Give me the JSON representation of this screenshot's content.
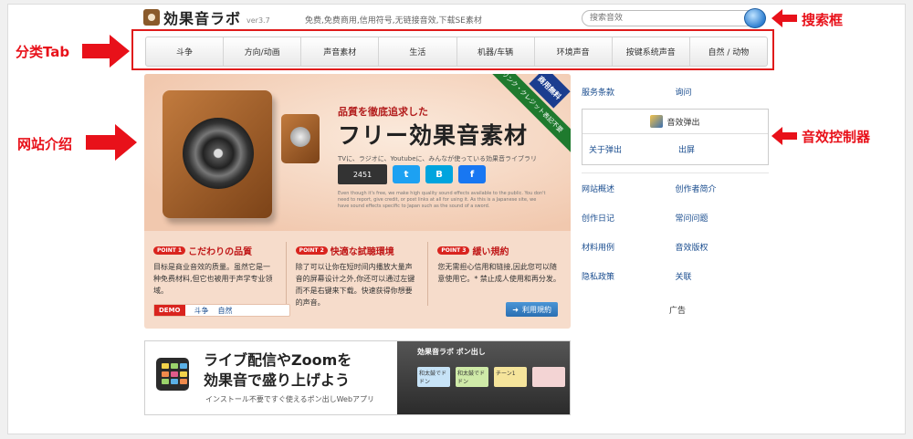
{
  "header": {
    "logo_text": "効果音ラボ",
    "version": "ver3.7",
    "tagline": "免费,免费商用,信用符号,无链接音效,下载SE素材",
    "search_placeholder": "搜索音效"
  },
  "annotations": {
    "search": "搜索框",
    "tabs": "分类Tab",
    "intro": "网站介绍",
    "sfx_controller": "音效控制器"
  },
  "nav": {
    "items": [
      "斗争",
      "方向/动画",
      "声音素材",
      "生活",
      "机器/车辆",
      "环境声音",
      "按键系统声音",
      "自然 / 动物"
    ]
  },
  "hero": {
    "kicker": "品質を徹底追求した",
    "title": "フリー効果音素材",
    "sub": "TVに、ラジオに、Youtubeに、みんなが使っている効果音ライブラリ",
    "counter": "2451",
    "en_text": "Even though it's free, we make high quality sound effects available to the public. You don't need to report, give credit, or post links at all for using it. As this is a Japanese site, we have sound effects specific to Japan such as the sound of a sword.",
    "ribbon": "リンク・クレジット表記不要",
    "ribbon_free": "商用無料",
    "points": [
      {
        "tag": "POINT 1",
        "title": "こだわりの品質",
        "text": "目标是商业音效的质量。虽然它是一种免费材料,但它也被用于声学专业领域。"
      },
      {
        "tag": "POINT 2",
        "title": "快適な試聴環境",
        "text": "除了可以让你在短时间内播放大量声音的屏幕设计之外,你还可以通过左键而不是右键来下载。快速获得你想要的声音。"
      },
      {
        "tag": "POINT 3",
        "title": "緩い規約",
        "text": "您无需担心信用和链接,因此您可以随意使用它。* 禁止成人使用和再分发。"
      }
    ],
    "demo_label": "DEMO",
    "demo_links": [
      "斗争",
      "自然"
    ],
    "terms_label": "利用規約"
  },
  "banner": {
    "title_line1": "ライブ配信やZoomを",
    "title_line2": "効果音で盛り上げよう",
    "sub": "インストール不要ですぐ使えるポン出しWebアプリ",
    "brand": "効果音ラボ ポン出し",
    "pads": [
      "和太鼓でドドン",
      "和太鼓でドドン",
      "チーン1",
      ""
    ]
  },
  "sidebar": {
    "row1": [
      "服务条款",
      "询问"
    ],
    "sfx_box": {
      "title": "音效弹出",
      "links": [
        "关于弹出",
        "出屏"
      ]
    },
    "rows": [
      [
        "网站概述",
        "创作者简介"
      ],
      [
        "创作日记",
        "常问问题"
      ],
      [
        "材料用例",
        "音效版权"
      ],
      [
        "隐私政策",
        "关联"
      ]
    ],
    "ad_label": "广告"
  },
  "colors": {
    "accent_red": "#e8111a",
    "link_blue": "#1a4d8f",
    "hero_bg": "#f6dccb"
  }
}
